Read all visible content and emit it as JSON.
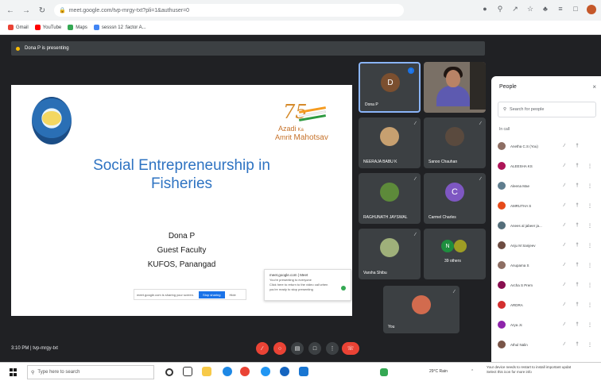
{
  "browser": {
    "url": "meet.google.com/tvp-mrgy-txt?pli=1&authuser=0",
    "bookmarks": [
      "Gmail",
      "YouTube",
      "Maps",
      "sesssn 12 :factor A..."
    ],
    "bookmark_colors": [
      "#ea4335",
      "#ff0000",
      "#34a853",
      "#4285f4"
    ]
  },
  "meet": {
    "presenting_label": "Dona P is presenting",
    "time_code": "3:10 PM  |  tvp-mrgy-txt"
  },
  "slide": {
    "logo_seventy": "75",
    "logo_azadi": "Azadi",
    "logo_ka": "Ka",
    "logo_amrit": "Amrit",
    "logo_mahotsav": "Mahotsav",
    "title_line1": "Social Entrepreneurship in",
    "title_line2": "Fisheries",
    "presenter": "Dona P",
    "role": "Guest Faculty",
    "institution": "KUFOS, Panangad",
    "share_text": "meet.google.com is sharing your screen.",
    "stop_label": "Stop sharing",
    "hide_label": "Hide",
    "notify_title": "meet.google.com  |  Meet",
    "notify_line1": "You're presenting to everyone",
    "notify_line2": "Click here to return to the video call when",
    "notify_line3": "you're ready to stop presenting"
  },
  "tiles": [
    {
      "name": "Dona P",
      "initial": "D",
      "color": "#7b4f2f"
    },
    {
      "name": "",
      "initial": "",
      "color": ""
    },
    {
      "name": "NEERAJA BABU K",
      "initial": "",
      "color": ""
    },
    {
      "name": "Sanoo Chauhan",
      "initial": "",
      "color": ""
    },
    {
      "name": "RAGHUNATH JAYSWAL",
      "initial": "",
      "color": ""
    },
    {
      "name": "Carmel Charles",
      "initial": "C",
      "color": "#7e57c2"
    },
    {
      "name": "Varsha Shibu",
      "initial": "",
      "color": ""
    },
    {
      "name": "39 others",
      "initial": "N",
      "color": "#1e8e3e"
    },
    {
      "name": "You",
      "initial": "",
      "color": ""
    }
  ],
  "people": {
    "title": "People",
    "close": "×",
    "search_placeholder": "Search for people",
    "section": "In call",
    "list": [
      {
        "name": "Anetha C.S (You)",
        "color": "#8d6e63"
      },
      {
        "name": "ALEESHA KS",
        "color": "#ad1457"
      },
      {
        "name": "Aleena Mae",
        "color": "#5f7d8e"
      },
      {
        "name": "AMRUTHA S",
        "color": "#e64a19"
      },
      {
        "name": "Anees al jabeer ja...",
        "color": "#546e7a"
      },
      {
        "name": "Anju M Sanjeev",
        "color": "#6d4c41"
      },
      {
        "name": "Anupama S",
        "color": "#8d6e63"
      },
      {
        "name": "Archa S Prem",
        "color": "#880e4f"
      },
      {
        "name": "ARDRA",
        "color": "#d32f2f"
      },
      {
        "name": "Arya Jc",
        "color": "#8e24aa"
      },
      {
        "name": "Athul Nalin",
        "color": "#795548"
      }
    ]
  },
  "taskbar": {
    "search_placeholder": "Type here to search",
    "weather": "29°C  Rain",
    "update_line1": "Your device needs to restart to install important updat",
    "update_line2": "Select this icon for more info"
  }
}
